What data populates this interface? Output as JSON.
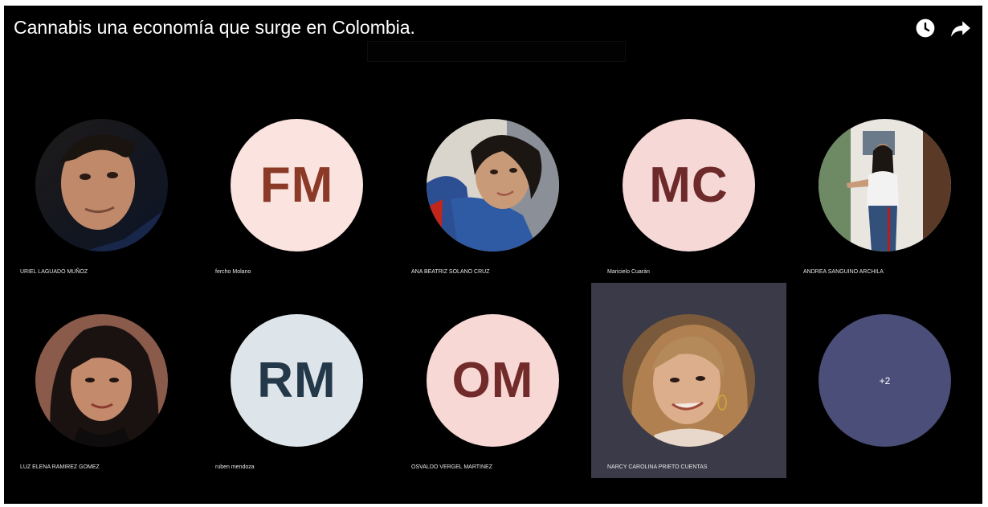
{
  "video": {
    "title": "Cannabis una economía que surge en Colombia."
  },
  "controls": {
    "watch_later_icon": "clock-icon",
    "share_icon": "share-arrow-icon"
  },
  "colors": {
    "background": "#000000",
    "active_tile": "#3a3a48",
    "overflow_circle": "#4b4e78"
  },
  "participants": [
    {
      "name": "URIEL  LAGUADO MUÑOZ",
      "avatar": "photo"
    },
    {
      "name": "fercho Molano",
      "initials": "FM"
    },
    {
      "name": "ANA BEATRIZ SOLANO CRUZ",
      "avatar": "photo"
    },
    {
      "name": "Maricielo Cuarán",
      "initials": "MC"
    },
    {
      "name": "ANDREA  SANGUINO ARCHILA",
      "avatar": "photo"
    },
    {
      "name": "LUZ ELENA RAMIREZ GOMEZ",
      "avatar": "photo"
    },
    {
      "name": "ruben mendoza",
      "initials": "RM"
    },
    {
      "name": "OSVALDO  VERGEL MARTINEZ",
      "initials": "OM"
    },
    {
      "name": "NARCY CAROLINA PRIETO CUENTAS",
      "avatar": "photo",
      "active_speaker": true
    }
  ],
  "overflow": {
    "label": "+2"
  }
}
